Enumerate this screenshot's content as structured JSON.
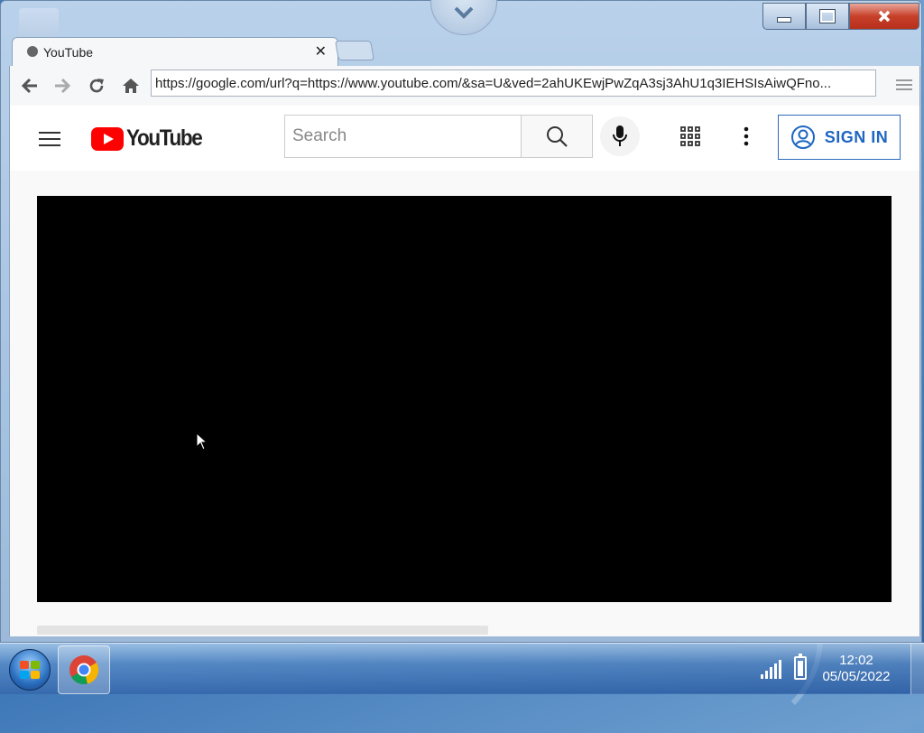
{
  "browser": {
    "tab_title": "YouTube",
    "tab_close_symbol": "✕",
    "url": "https://google.com/url?q=https://www.youtube.com/&sa=U&ved=2ahUKEwjPwZqA3sj3AhU1q3IEHSIsAiwQFno...",
    "icons": [
      "back-icon",
      "forward-icon",
      "reload-icon",
      "home-icon",
      "menu-icon"
    ]
  },
  "youtube": {
    "logo_text": "YouTube",
    "search_placeholder": "Search",
    "signin_label": "SIGN IN",
    "colors": {
      "brand_red": "#ff0000",
      "signin_blue": "#1e66c2"
    }
  },
  "taskbar": {
    "time": "12:02",
    "date": "05/05/2022"
  }
}
